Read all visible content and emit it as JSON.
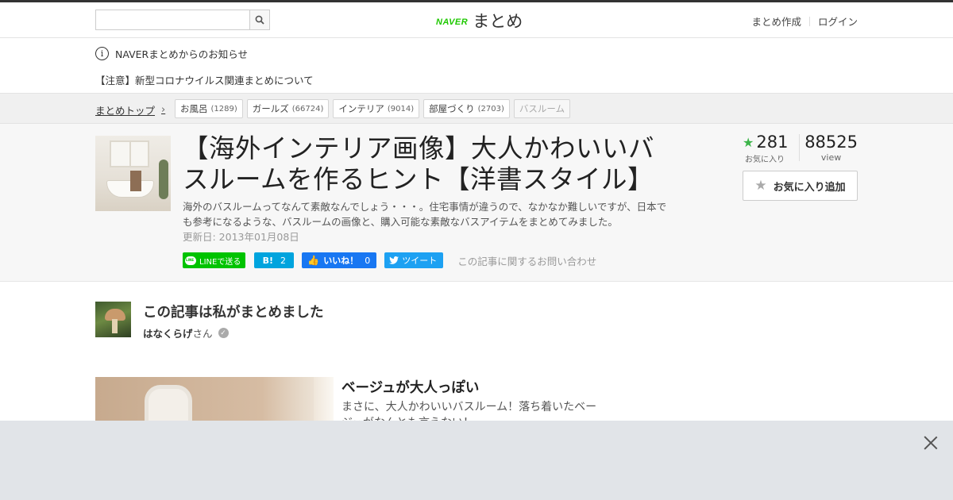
{
  "header": {
    "logo_naver": "NAVER",
    "logo_matome": "まとめ",
    "search_placeholder": "",
    "links": [
      "まとめ作成",
      "ログイン"
    ]
  },
  "notice": {
    "title": "NAVERまとめからのお知らせ",
    "item": "【注意】新型コロナウイルス関連まとめについて"
  },
  "breadcrumb": {
    "top": "まとめトップ",
    "tags": [
      {
        "label": "お風呂",
        "count": "(1289)"
      },
      {
        "label": "ガールズ",
        "count": "(66724)"
      },
      {
        "label": "インテリア",
        "count": "(9014)"
      },
      {
        "label": "部屋づくり",
        "count": "(2703)"
      }
    ],
    "current": "バスルーム"
  },
  "article": {
    "title": "【海外インテリア画像】大人かわいいバスルームを作るヒント【洋書スタイル】",
    "description": "海外のバスルームってなんて素敵なんでしょう・・・。住宅事情が違うので、なかなか難しいですが、日本でも参考になるような、バスルームの画像と、購入可能な素敵なバスアイテムをまとめてみました。",
    "updated": "更新日: 2013年01月08日",
    "favorites": "281",
    "favorites_label": "お気に入り",
    "views": "88525",
    "views_label": "view",
    "fav_button": "お気に入り追加"
  },
  "share": {
    "line": "LINEで送る",
    "hatena_icon": "B!",
    "hatena_count": "2",
    "fb_label": "いいね！",
    "fb_count": "0",
    "tweet": "ツイート",
    "contact": "この記事に関するお問い合わせ"
  },
  "author": {
    "heading": "この記事は私がまとめました",
    "name": "はなくらげ",
    "suffix": "さん"
  },
  "item": {
    "title": "ベージュが大人っぽい",
    "description": "まさに、大人かわいいバスルーム！落ち着いたベージュがなんとも言えない！"
  },
  "colors": {
    "naver_green": "#1ec800",
    "line": "#00c300",
    "hatena": "#00a4de",
    "facebook": "#1877f2",
    "twitter": "#1da1f2",
    "fav_star": "#3db54a"
  }
}
